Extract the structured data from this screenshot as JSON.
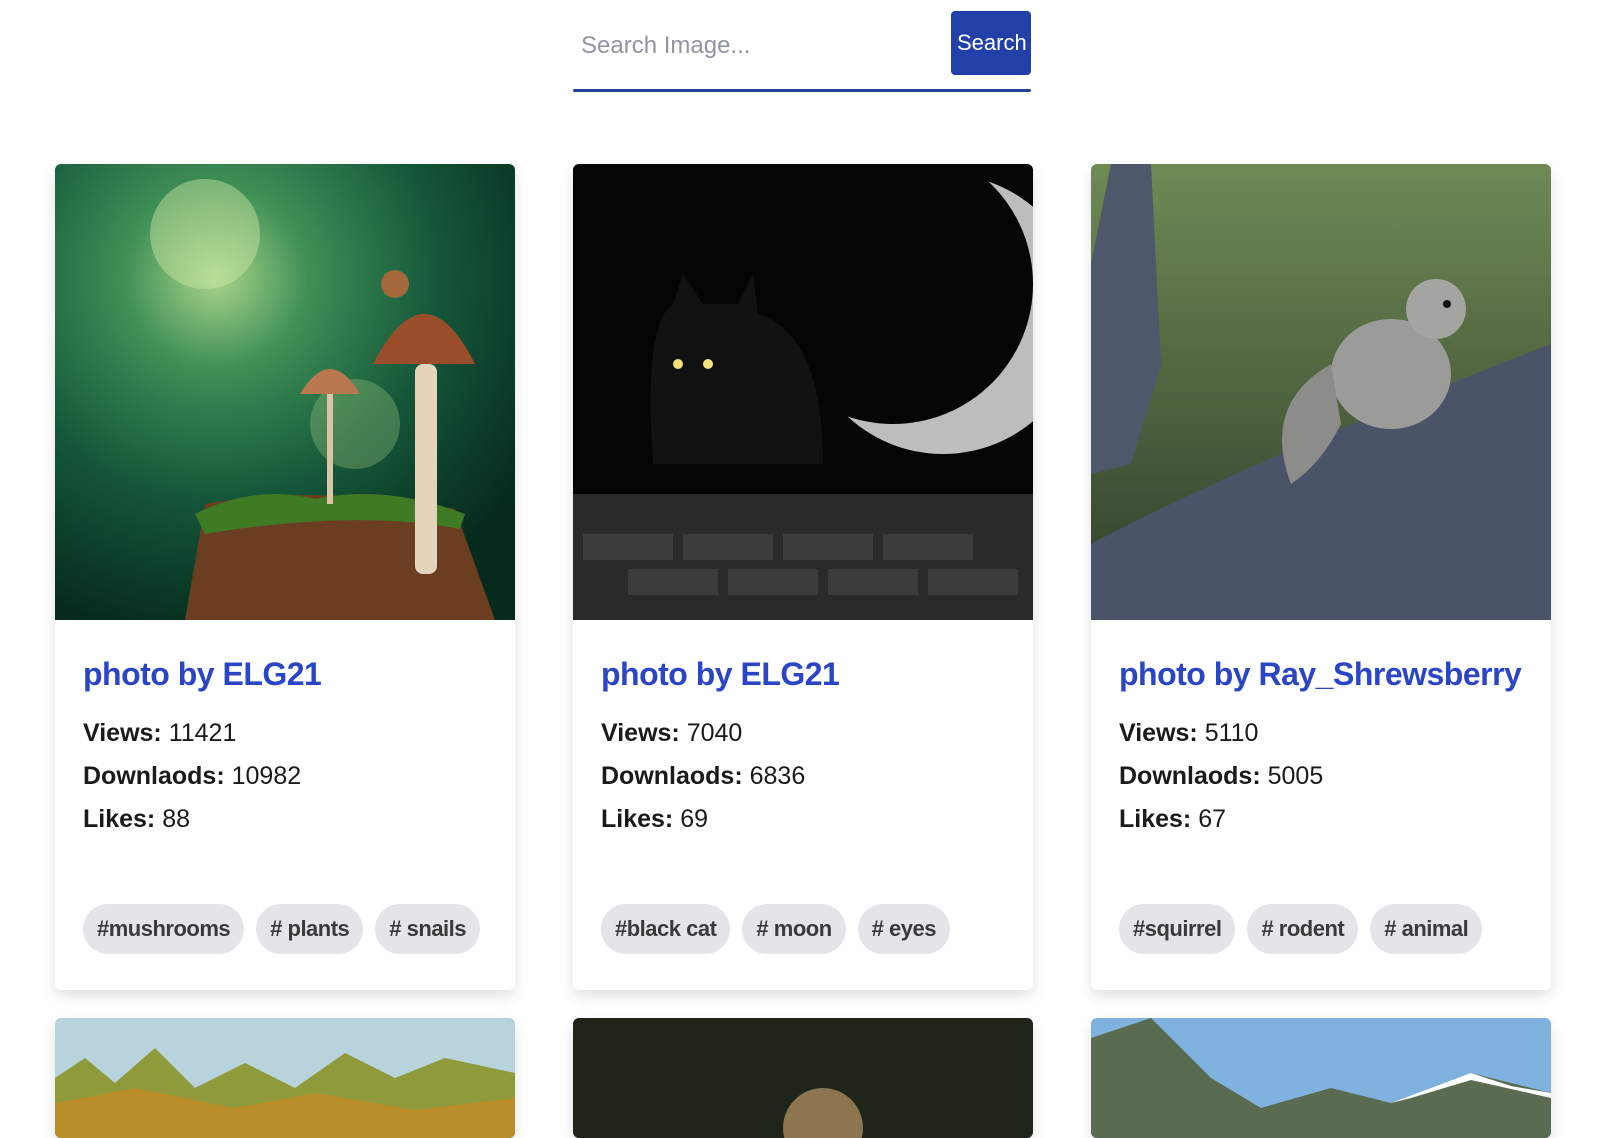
{
  "search": {
    "placeholder": "Search Image...",
    "button_label": "Search",
    "accent": "#2240a8"
  },
  "cards": [
    {
      "title": "photo by ELG21",
      "views_label": "Views:",
      "views": "11421",
      "downloads_label": "Downlaods:",
      "downloads": "10982",
      "likes_label": "Likes:",
      "likes": "88",
      "tags": [
        "#mushrooms",
        "# plants",
        "# snails"
      ]
    },
    {
      "title": "photo by ELG21",
      "views_label": "Views:",
      "views": "7040",
      "downloads_label": "Downlaods:",
      "downloads": "6836",
      "likes_label": "Likes:",
      "likes": "69",
      "tags": [
        "#black cat",
        "# moon",
        "# eyes"
      ]
    },
    {
      "title": "photo by Ray_Shrewsberry",
      "views_label": "Views:",
      "views": "5110",
      "downloads_label": "Downlaods:",
      "downloads": "5005",
      "likes_label": "Likes:",
      "likes": "67",
      "tags": [
        "#squirrel",
        "# rodent",
        "# animal"
      ]
    }
  ],
  "colors": {
    "title": "#2a45c6",
    "tag_bg": "#e4e5e8"
  }
}
